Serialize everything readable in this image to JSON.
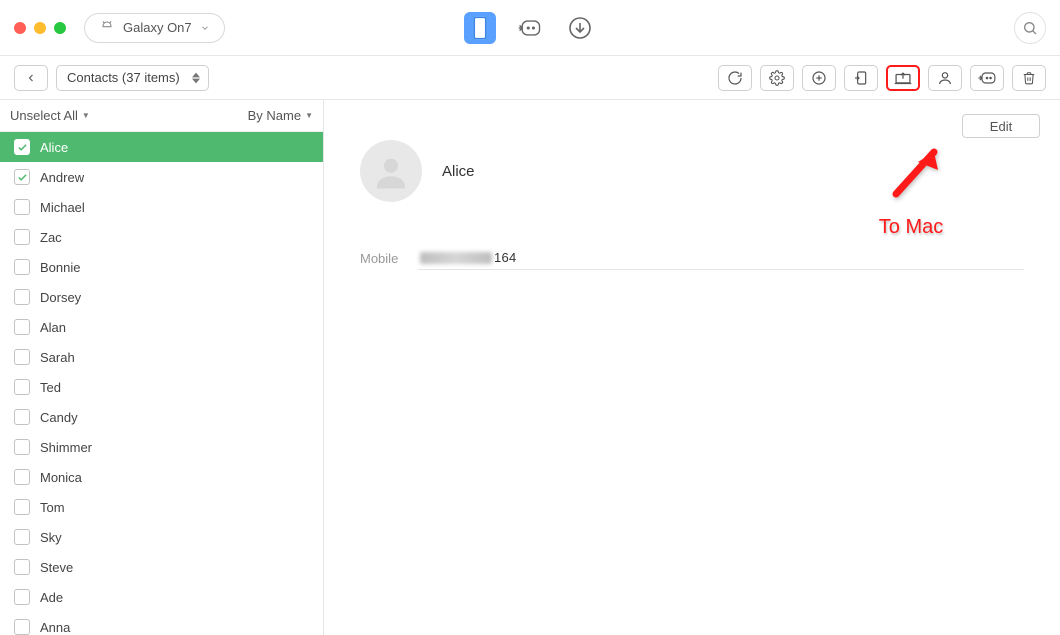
{
  "device": {
    "name": "Galaxy On7"
  },
  "view": {
    "label": "Contacts (37 items)"
  },
  "list_header": {
    "select_toggle": "Unselect All",
    "sort_label": "By Name"
  },
  "contacts": [
    {
      "name": "Alice",
      "checked": true,
      "selected": true
    },
    {
      "name": "Andrew",
      "checked": true,
      "selected": false
    },
    {
      "name": "Michael",
      "checked": false,
      "selected": false
    },
    {
      "name": "Zac",
      "checked": false,
      "selected": false
    },
    {
      "name": "Bonnie",
      "checked": false,
      "selected": false
    },
    {
      "name": "Dorsey",
      "checked": false,
      "selected": false
    },
    {
      "name": "Alan",
      "checked": false,
      "selected": false
    },
    {
      "name": "Sarah",
      "checked": false,
      "selected": false
    },
    {
      "name": "Ted",
      "checked": false,
      "selected": false
    },
    {
      "name": "Candy",
      "checked": false,
      "selected": false
    },
    {
      "name": "Shimmer",
      "checked": false,
      "selected": false
    },
    {
      "name": "Monica",
      "checked": false,
      "selected": false
    },
    {
      "name": "Tom",
      "checked": false,
      "selected": false
    },
    {
      "name": "Sky",
      "checked": false,
      "selected": false
    },
    {
      "name": "Steve",
      "checked": false,
      "selected": false
    },
    {
      "name": "Ade",
      "checked": false,
      "selected": false
    },
    {
      "name": "Anna",
      "checked": false,
      "selected": false
    }
  ],
  "detail": {
    "name": "Alice",
    "field_label": "Mobile",
    "phone_visible_suffix": "164",
    "edit_label": "Edit"
  },
  "annotation": {
    "label": "To Mac"
  }
}
